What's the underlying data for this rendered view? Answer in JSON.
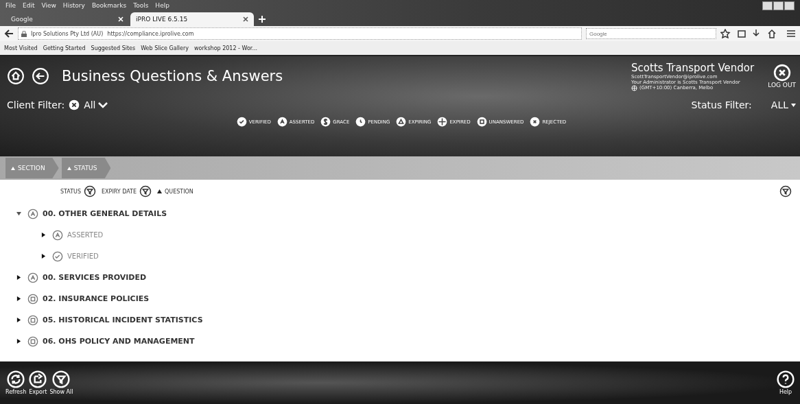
{
  "browser": {
    "menu": [
      "File",
      "Edit",
      "View",
      "History",
      "Bookmarks",
      "Tools",
      "Help"
    ],
    "tabs": [
      {
        "label": "Google",
        "selected": false
      },
      {
        "label": "iPRO LIVE 6.5.15",
        "selected": true
      }
    ],
    "address": {
      "identity": "Ipro Solutions Pty Ltd (AU)",
      "url": "https://compliance.iprolive.com"
    },
    "search": {
      "placeholder": "Google"
    },
    "bookmarks": [
      "Most Visited",
      "Getting Started",
      "Suggested Sites",
      "Web Slice Gallery",
      "workshop 2012 - Wor..."
    ]
  },
  "app": {
    "title": "Business Questions & Answers",
    "user": {
      "name": "Scotts Transport Vendor",
      "email": "ScottTransportVendor@iprolive.com",
      "admin": "Your Administrator is  Scotts Transport Vendor",
      "timezone": "(GMT+10:00) Canberra, Melbo"
    },
    "logout": "LOG OUT",
    "client_filter": {
      "label": "Client Filter:",
      "value": "All"
    },
    "status_filter": {
      "label": "Status Filter:",
      "value": "ALL"
    },
    "legend": [
      {
        "kind": "verified",
        "label": "VERIFIED"
      },
      {
        "kind": "asserted",
        "label": "ASSERTED"
      },
      {
        "kind": "grace",
        "label": "GRACE"
      },
      {
        "kind": "pending",
        "label": "PENDING"
      },
      {
        "kind": "expiring",
        "label": "EXPIRING"
      },
      {
        "kind": "expired",
        "label": "EXPIRED"
      },
      {
        "kind": "unanswered",
        "label": "UNANSWERED"
      },
      {
        "kind": "rejected",
        "label": "REJECTED"
      }
    ],
    "breadcrumbs": [
      "SECTION",
      "STATUS"
    ],
    "columns": [
      {
        "label": "STATUS",
        "kind": "filter"
      },
      {
        "label": "EXPIRY DATE",
        "kind": "filter"
      },
      {
        "label": "QUESTION",
        "kind": "sort"
      }
    ],
    "tree": [
      {
        "label": "00. OTHER GENERAL DETAILS",
        "kind": "asserted",
        "expanded": true,
        "children": [
          {
            "label": "ASSERTED",
            "kind": "asserted",
            "expanded": false
          },
          {
            "label": "VERIFIED",
            "kind": "verified",
            "expanded": false
          }
        ]
      },
      {
        "label": "00. SERVICES PROVIDED",
        "kind": "asserted",
        "expanded": false
      },
      {
        "label": "02. INSURANCE POLICIES",
        "kind": "unanswered",
        "expanded": false
      },
      {
        "label": "05. HISTORICAL INCIDENT STATISTICS",
        "kind": "unanswered",
        "expanded": false
      },
      {
        "label": "06. OHS POLICY AND MANAGEMENT",
        "kind": "unanswered",
        "expanded": false
      }
    ],
    "footer": [
      {
        "kind": "refresh",
        "label": "Refresh"
      },
      {
        "kind": "export",
        "label": "Export"
      },
      {
        "kind": "filter",
        "label": "Show All"
      }
    ],
    "help": "Help"
  }
}
